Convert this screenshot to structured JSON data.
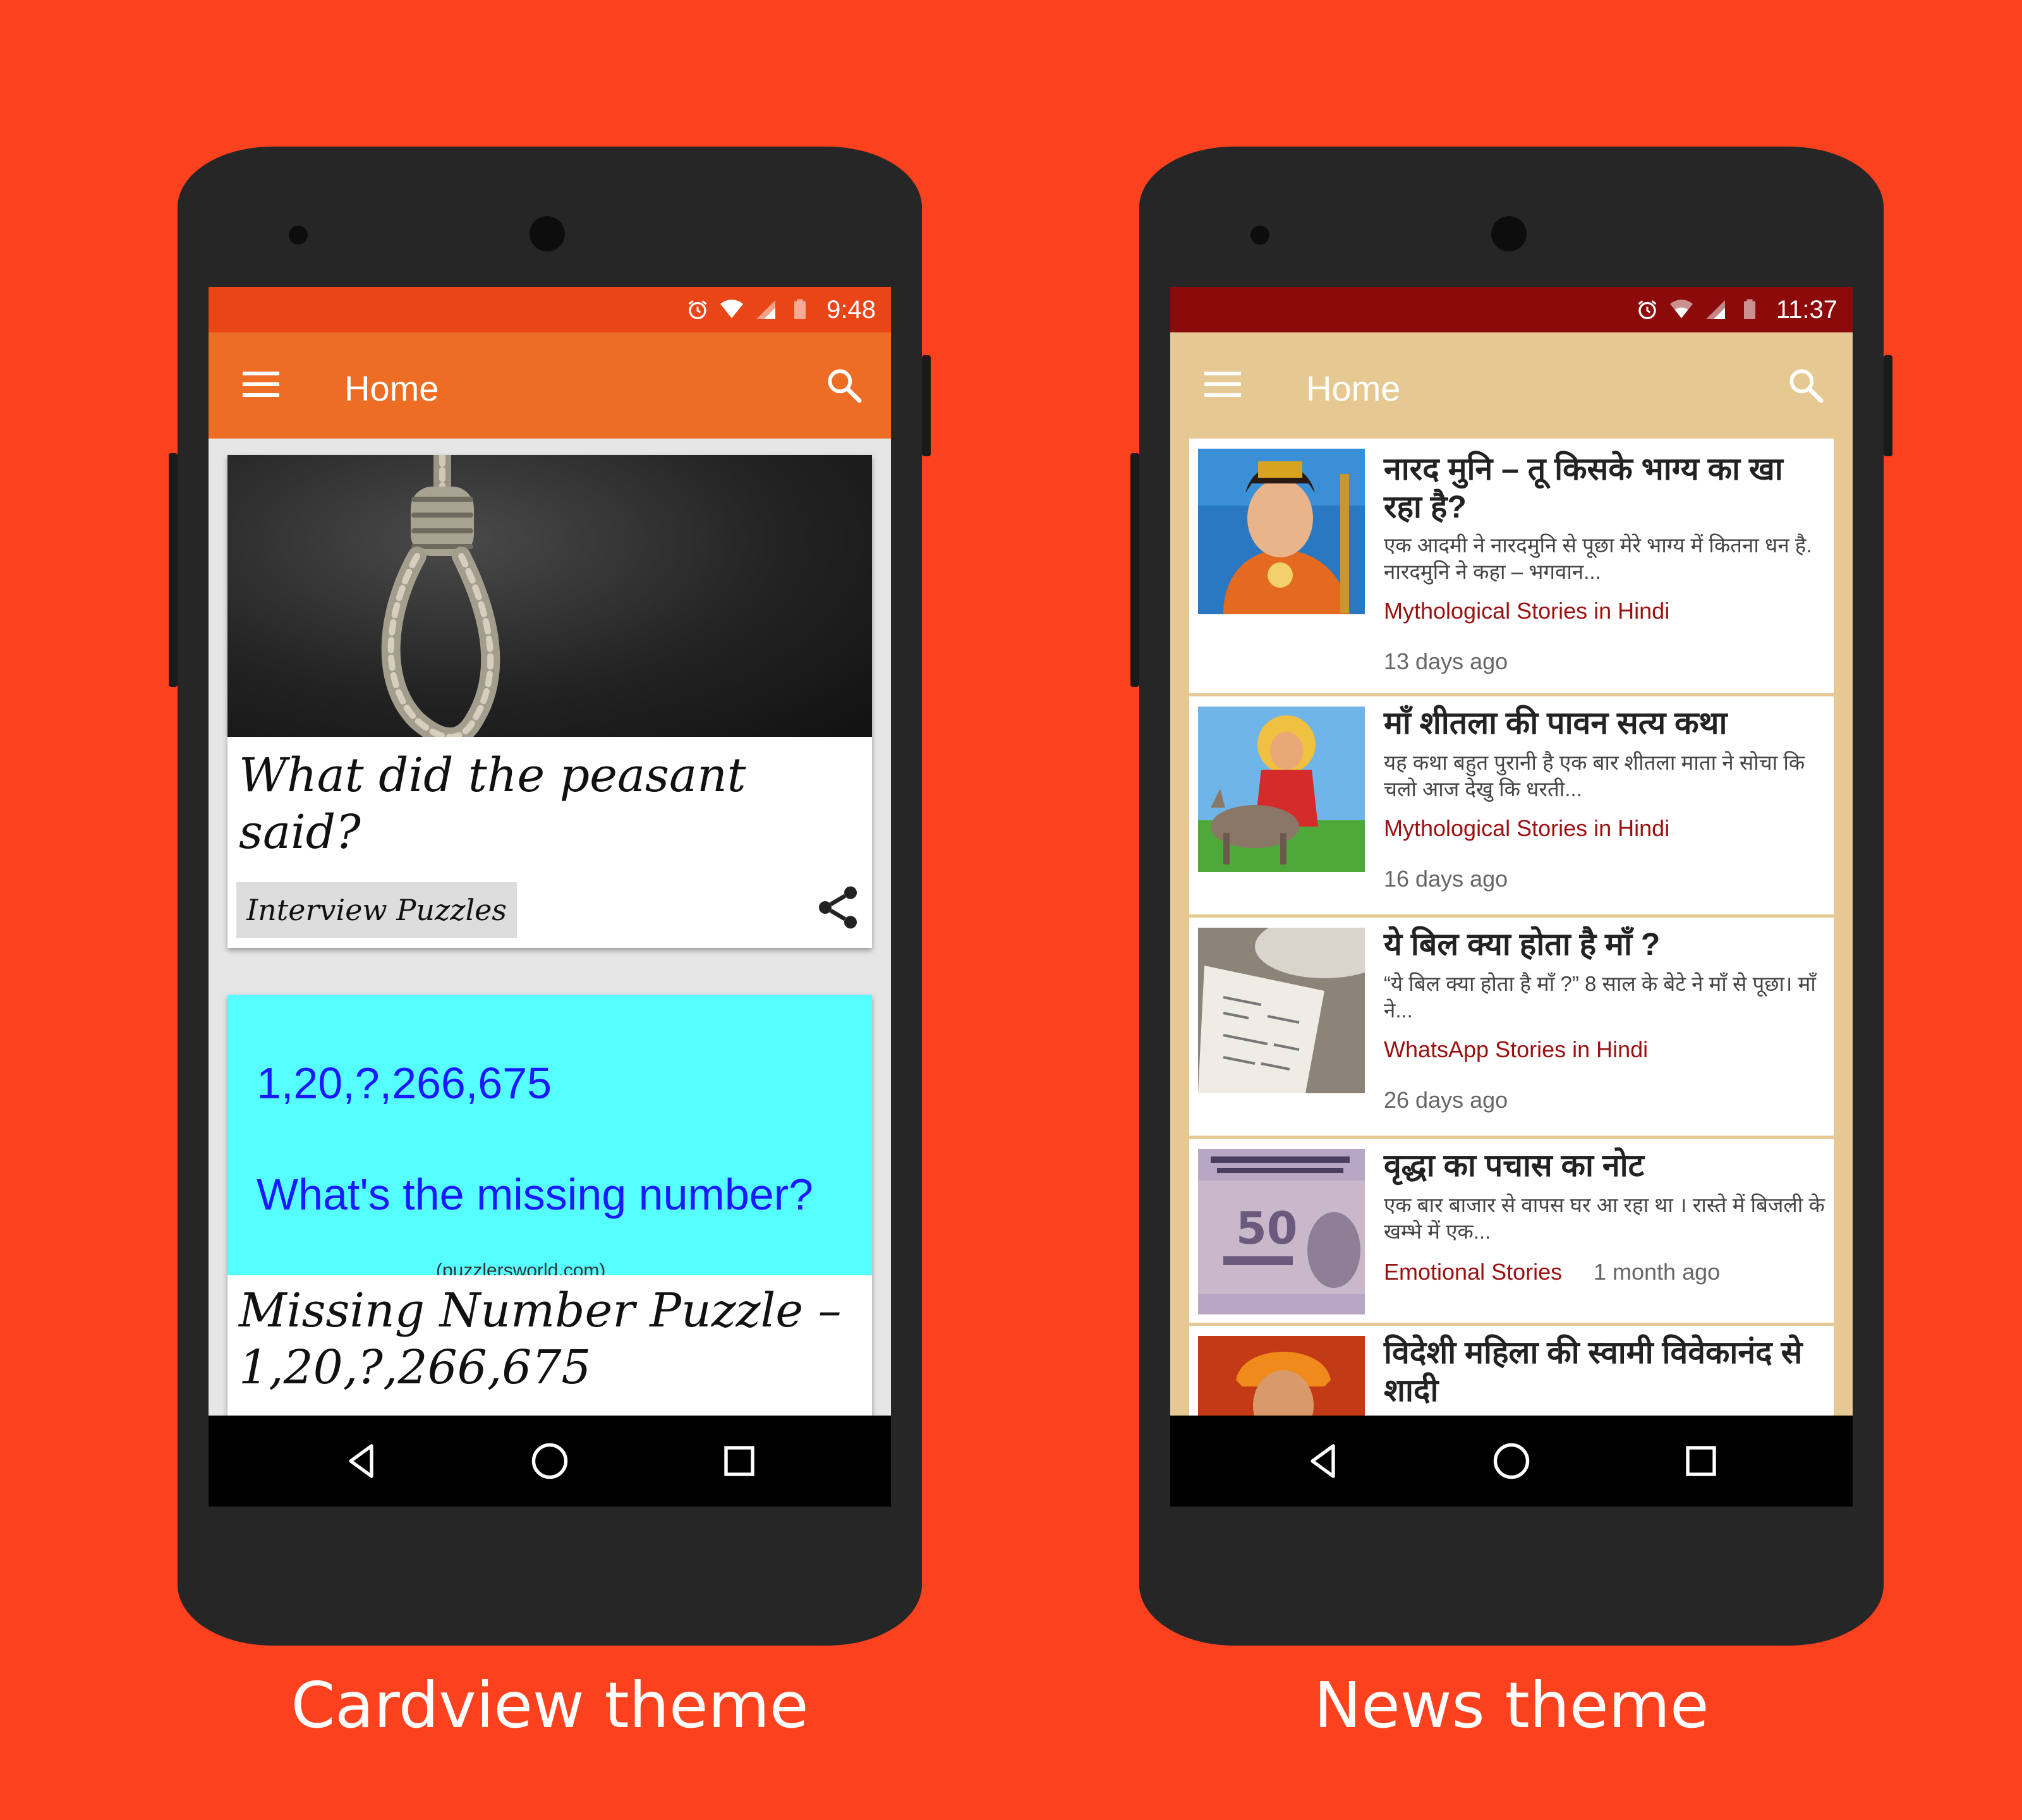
{
  "colors": {
    "background": "#FC411E",
    "cardview_statusbar": "#EA4517",
    "cardview_appbar": "#EE6D24",
    "news_statusbar": "#8C0A0A",
    "news_appbar": "#E6C992",
    "news_category": "#9B1010"
  },
  "cardview": {
    "status": {
      "time": "9:48"
    },
    "appbar": {
      "title": "Home"
    },
    "cards": [
      {
        "image_icon": "noose-photo",
        "title": "What did the peasant said?",
        "tag": "Interview Puzzles"
      },
      {
        "image_line1": "1,20,?,266,675",
        "image_line2": "What's the missing number?",
        "image_watermark": "(puzzlersworld.com)",
        "title": "Missing Number Puzzle – 1,20,?,266,675"
      }
    ],
    "caption": "Cardview theme"
  },
  "news": {
    "status": {
      "time": "11:37"
    },
    "appbar": {
      "title": "Home"
    },
    "items": [
      {
        "thumb_icon": "narad-muni-photo",
        "title": "नारद मुनि – तू किसके भाग्य का खा रहा है?",
        "excerpt": "एक आदमी ने नारदमुनि से पूछा मेरे भाग्य में कितना धन है. नारदमुनि ने कहा – भगवान...",
        "category": "Mythological Stories in Hindi",
        "time": "13 days ago"
      },
      {
        "thumb_icon": "sheetla-mata-photo",
        "title": "माँ शीतला की पावन सत्य कथा",
        "excerpt": "यह कथा बहुत पुरानी है एक बार शीतला माता ने सोचा कि चलो आज देखु कि धरती...",
        "category": "Mythological Stories in Hindi",
        "time": "16 days ago"
      },
      {
        "thumb_icon": "restaurant-bill-photo",
        "title": "ये बिल क्या होता है माँ ?",
        "excerpt": "“ये बिल क्या होता है माँ ?” 8 साल के बेटे ने माँ से पूछा। माँ ने...",
        "category": "WhatsApp Stories in Hindi",
        "time": "26 days ago"
      },
      {
        "thumb_icon": "fifty-rupee-note-photo",
        "title": "वृद्धा का पचास का नोट",
        "excerpt": "एक बार बाजार से वापस घर आ रहा था । रास्ते में बिजली के खम्भे में एक...",
        "category": "Emotional Stories",
        "time": "1 month ago"
      },
      {
        "thumb_icon": "vivekananda-photo",
        "title": "विदेशी महिला की स्वामी विवेकानंद से शादी"
      }
    ],
    "caption": "News theme"
  }
}
